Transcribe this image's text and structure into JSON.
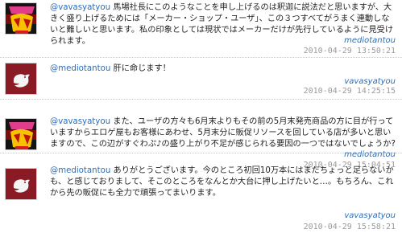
{
  "tweets": [
    {
      "avatar_icon": "mediotan-logo-icon",
      "user": "@vavasyatyou",
      "text": "馬場社長にこのようなことを申し上げるのは釈迦に説法だと思いますが、大きく盛り上げるためには「メーカー・ショップ・ユーザ」、この３つすべてがうまく連動しないと難しいと思います。私の印象としては現状ではメーカーだけが先行しているように見受けられます。",
      "source": "mediotantou",
      "time": "2010-04-29 13:50:21"
    },
    {
      "avatar_icon": "twitter-bird-icon",
      "user": "@mediotantou",
      "text": "肝に命じます！",
      "source": "vavasyatyou",
      "time": "2010-04-29 14:25:15"
    },
    {
      "avatar_icon": "mediotan-logo-icon",
      "user": "@vavasyatyou",
      "text": "また、ユーザの方々も6月末よりもその前の5月末発売商品の方に目が行っていますからエロゲ屋もお客様にあわせ、5月末分に販促リソースを回している店が多いと思いますので、この辺がすぐわぷ♪の盛り上がり不足が感じられる要因の一つではないでしょうか?",
      "source": "mediotantou",
      "time": "2010-04-29 15:04:51"
    },
    {
      "avatar_icon": "twitter-bird-icon",
      "user": "@mediotantou",
      "text": "ありがとうございます。今のところ初回10万本にはまだちょっと足らないかも、と感じておりまして、そこのところをなんとか大台に押し上げたいと…。もちろん、これから先の販促にも全力で頑張ってまいります。",
      "source": "vavasyatyou",
      "time": "2010-04-29 15:58:21"
    }
  ]
}
